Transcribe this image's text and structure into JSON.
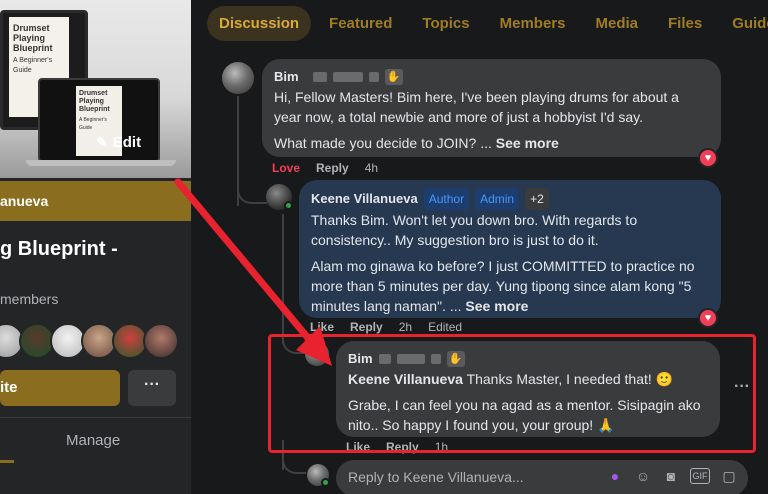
{
  "left_panel": {
    "cover": {
      "book_back_title": "Drumset Playing Blueprint",
      "book_back_sub": "A Beginner's Guide",
      "book_front_title": "Drumset Playing Blueprint",
      "book_front_sub": "A Beginner's Guide",
      "edit_label": "Edit",
      "edit_icon": "pencil-icon"
    },
    "group_bar_text": "anueva",
    "group_title": "g Blueprint -",
    "members_label": "members",
    "invite_label": "ite",
    "more_label": "···",
    "manage_label": "Manage"
  },
  "tabs": [
    "Discussion",
    "Featured",
    "Topics",
    "Members",
    "Media",
    "Files",
    "Guides"
  ],
  "active_tab": "Discussion",
  "comments": [
    {
      "author": "Bim",
      "text_1": "Hi, Fellow Masters! Bim here, I've been playing drums for about a year now, a total newbie and more of just a hobbyist I'd say.",
      "text_2": "What made you decide to JOIN? ...",
      "see_more": "See more",
      "action_love": "Love",
      "action_reply": "Reply",
      "time": "4h",
      "reaction_icon": "heart-icon"
    },
    {
      "author": "Keene Villanueva",
      "badges": [
        "Author",
        "Admin",
        "+2"
      ],
      "text_1": "Thanks Bim. Won't let you down bro. With regards to consistency.. My suggestion bro is just to do it.",
      "text_2": "Alam mo ginawa ko before? I just COMMITTED to practice no more than 5 minutes per day. Yung tipong since alam kong \"5 minutes lang naman\". ...",
      "see_more": "See more",
      "action_like": "Like",
      "action_reply": "Reply",
      "time": "2h",
      "edited": "Edited",
      "reaction_icon": "heart-icon"
    },
    {
      "author": "Bim",
      "mention": "Keene Villanueva",
      "text_1": "Thanks Master, I needed that! 🙂",
      "text_2": "Grabe, I can feel you na agad as a mentor. Sisipagin ako nito.. So happy I found you, your group! 🙏",
      "action_like": "Like",
      "action_reply": "Reply",
      "time": "1h"
    }
  ],
  "reply_box": {
    "placeholder": "Reply to Keene Villanueva...",
    "icons": [
      "avatar-dot-icon",
      "emoji-icon",
      "camera-icon",
      "gif-icon",
      "sticker-icon"
    ],
    "gif_label": "GIF"
  },
  "colors": {
    "accent_gold": "#8a6d1f",
    "tab_text": "#a07c22",
    "annotation_red": "#e8222e",
    "love_red": "#f33e58",
    "author_bubble": "#263951"
  }
}
